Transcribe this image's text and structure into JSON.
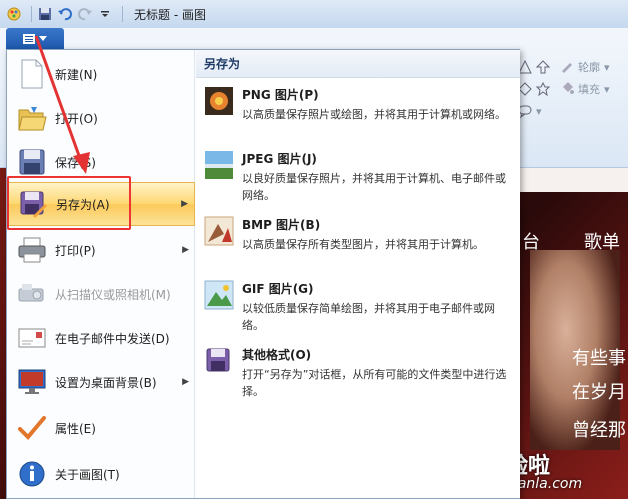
{
  "window": {
    "title": "无标题 - 画图"
  },
  "ribbon": {
    "outline_label": "轮廓",
    "fill_label": "填充"
  },
  "background_text": {
    "t1": "台",
    "t2": "歌单",
    "t3": "有些事",
    "t4": "在岁月",
    "t5": "曾经那",
    "watermark": "经验啦",
    "watermark_url": "jingyanla.com"
  },
  "menu": {
    "items": [
      {
        "label": "新建(N)",
        "icon": "new-file-icon"
      },
      {
        "label": "打开(O)",
        "icon": "open-folder-icon"
      },
      {
        "label": "保存(S)",
        "icon": "save-icon"
      },
      {
        "label": "另存为(A)",
        "icon": "save-as-icon"
      },
      {
        "label": "打印(P)",
        "icon": "printer-icon"
      },
      {
        "label": "从扫描仪或照相机(M)",
        "icon": "scanner-icon"
      },
      {
        "label": "在电子邮件中发送(D)",
        "icon": "email-icon"
      },
      {
        "label": "设置为桌面背景(B)",
        "icon": "desktop-icon"
      },
      {
        "label": "属性(E)",
        "icon": "checkmark-icon"
      },
      {
        "label": "关于画图(T)",
        "icon": "info-icon"
      }
    ]
  },
  "submenu": {
    "header": "另存为",
    "items": [
      {
        "title": "PNG 图片(P)",
        "desc": "以高质量保存照片或绘图，并将其用于计算机或网络。"
      },
      {
        "title": "JPEG 图片(J)",
        "desc": "以良好质量保存照片，并将其用于计算机、电子邮件或网络。"
      },
      {
        "title": "BMP 图片(B)",
        "desc": "以高质量保存所有类型图片，并将其用于计算机。"
      },
      {
        "title": "GIF 图片(G)",
        "desc": "以较低质量保存简单绘图，并将其用于电子邮件或网络。"
      },
      {
        "title": "其他格式(O)",
        "desc": "打开“另存为”对话框，从所有可能的文件类型中进行选择。"
      }
    ]
  },
  "colors": {
    "highlight": "#fed772",
    "annotation": "#e33333"
  }
}
